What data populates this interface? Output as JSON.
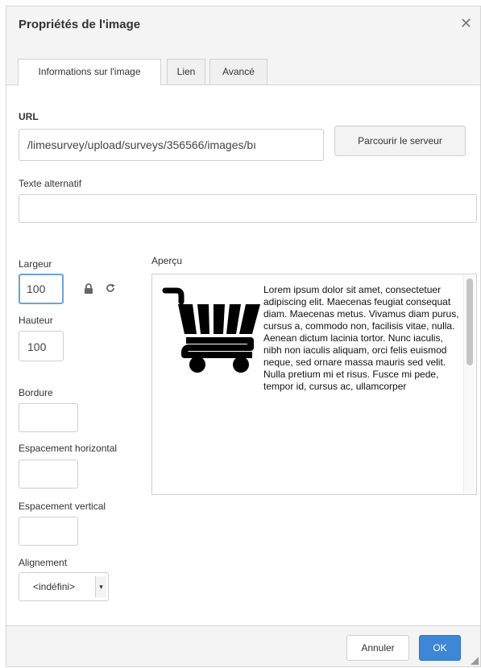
{
  "dialog": {
    "title": "Propriétés de l'image",
    "close_glyph": "✕"
  },
  "tabs": [
    {
      "label": "Informations sur l'image",
      "active": true
    },
    {
      "label": "Lien",
      "active": false
    },
    {
      "label": "Avancé",
      "active": false
    }
  ],
  "url": {
    "label": "URL",
    "value": "/limesurvey/upload/surveys/356566/images/bı",
    "browse_label": "Parcourir le serveur"
  },
  "alt_text": {
    "label": "Texte alternatif",
    "value": ""
  },
  "width": {
    "label": "Largeur",
    "value": "100"
  },
  "height": {
    "label": "Hauteur",
    "value": "100"
  },
  "border": {
    "label": "Bordure",
    "value": ""
  },
  "hspace": {
    "label": "Espacement horizontal",
    "value": ""
  },
  "vspace": {
    "label": "Espacement vertical",
    "value": ""
  },
  "align": {
    "label": "Alignement",
    "value": "<indéfini>"
  },
  "preview": {
    "label": "Aperçu",
    "text": "Lorem ipsum dolor sit amet, consectetuer adipiscing elit. Maecenas feugiat consequat diam. Maecenas metus. Vivamus diam purus, cursus a, commodo non, facilisis vitae, nulla. Aenean dictum lacinia tortor. Nunc iaculis, nibh non iaculis aliquam, orci felis euismod neque, sed ornare massa mauris sed velit. Nulla pretium mi et risus. Fusce mi pede, tempor id, cursus ac, ullamcorper"
  },
  "icons": {
    "lock": "lock-icon",
    "reset": "reset-size-icon",
    "cart": "shopping-cart-icon"
  },
  "footer": {
    "cancel_label": "Annuler",
    "ok_label": "OK"
  },
  "colors": {
    "primary": "#3e86d6",
    "focus_border": "#6aa2dc"
  }
}
